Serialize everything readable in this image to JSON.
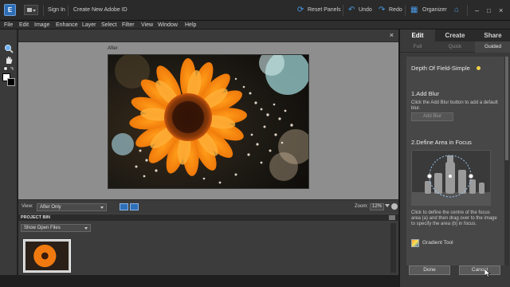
{
  "topbar": {
    "sign_in": "Sign In",
    "create_id": "Create New Adobe ID",
    "reset_panels": "Reset Panels",
    "undo": "Undo",
    "redo": "Redo",
    "organizer": "Organizer",
    "app_icon_letter": "E"
  },
  "menu": {
    "items": [
      "File",
      "Edit",
      "Image",
      "Enhance",
      "Layer",
      "Select",
      "Filter",
      "View",
      "Window",
      "Help"
    ]
  },
  "document": {
    "after_label": "After",
    "close": "×"
  },
  "viewbar": {
    "view_label": "View:",
    "view_value": "After Only",
    "zoom_label": "Zoom:",
    "zoom_value": "12%"
  },
  "bin": {
    "title": "PROJECT BIN",
    "filter_value": "Show Open Files"
  },
  "panel": {
    "tabs": [
      "Edit",
      "Create",
      "Share"
    ],
    "active_tab": "Edit",
    "sub_tabs": [
      "Full",
      "Quick",
      "Guided"
    ],
    "active_sub_tab": "Guided",
    "guide_title": "Depth Of Field-Simple",
    "step1_title": "1.Add Blur",
    "step1_desc": "Click the Add Blur button to add a default blur.",
    "add_blur_button": "Add Blur",
    "step2_title": "2.Define Area in Focus",
    "step2_desc": "Click to define the centre of the focus area (a) and then drag over to the image to specify the area (b) in focus.",
    "gradient_tool": "Gradient Tool",
    "done": "Done",
    "cancel": "Cancel"
  },
  "colors": {
    "accent": "#4a9be8",
    "panel_bg": "#3a3a3a",
    "canvas_bg": "#8e8e8e"
  }
}
